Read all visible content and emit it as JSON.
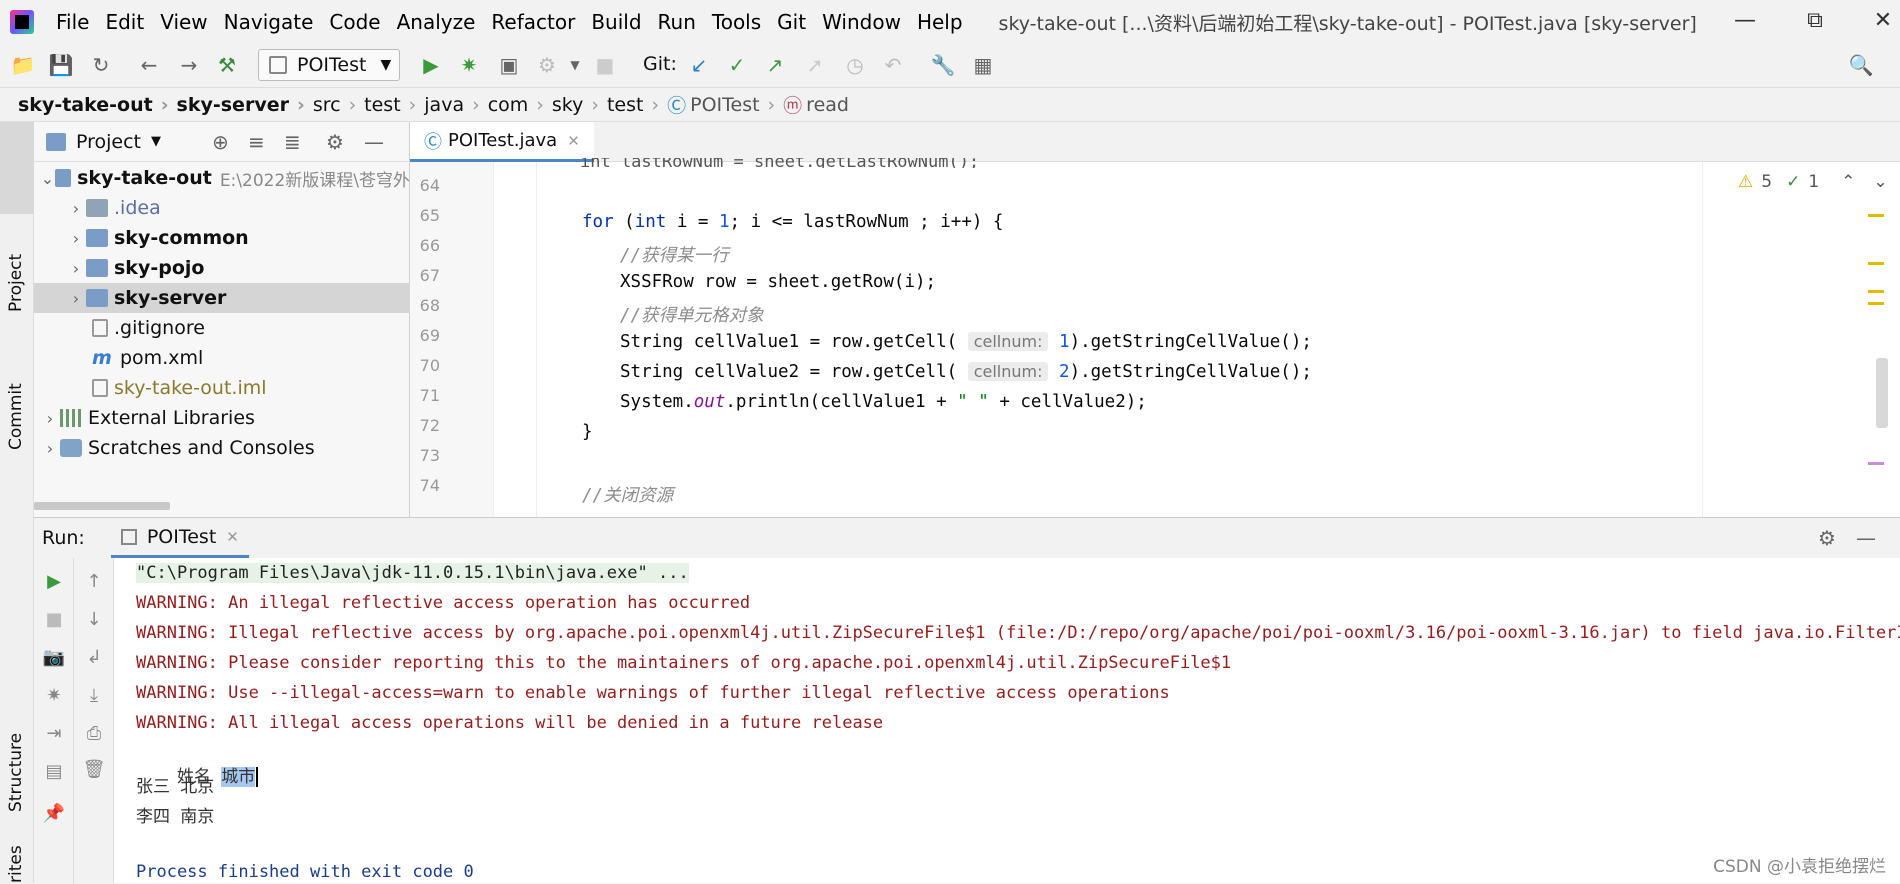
{
  "menubar": {
    "items": [
      "File",
      "Edit",
      "View",
      "Navigate",
      "Code",
      "Analyze",
      "Refactor",
      "Build",
      "Run",
      "Tools",
      "Git",
      "Window",
      "Help"
    ],
    "window_title": "sky-take-out [...\\资料\\后端初始工程\\sky-take-out] - POITest.java [sky-server]"
  },
  "toolbar": {
    "run_config": "POITest",
    "git_label": "Git:"
  },
  "breadcrumb": [
    "sky-take-out",
    "sky-server",
    "src",
    "test",
    "java",
    "com",
    "sky",
    "test",
    "POITest",
    "read"
  ],
  "left_strip": {
    "tab1": "Project",
    "tab2": "Commit",
    "tab3": "Structure",
    "tab4": "rites"
  },
  "project_panel": {
    "title": "Project",
    "tree": [
      {
        "label": "sky-take-out",
        "extra": "E:\\2022新版课程\\苍穹外",
        "level": 0,
        "expanded": true,
        "bold": true
      },
      {
        "label": ".idea",
        "level": 1,
        "color": "#5b6ea8"
      },
      {
        "label": "sky-common",
        "level": 1,
        "bold": true
      },
      {
        "label": "sky-pojo",
        "level": 1,
        "bold": true
      },
      {
        "label": "sky-server",
        "level": 1,
        "bold": true,
        "selected": true
      },
      {
        "label": ".gitignore",
        "level": 2
      },
      {
        "label": "pom.xml",
        "level": 2
      },
      {
        "label": "sky-take-out.iml",
        "level": 2,
        "color": "#8a7a2a"
      },
      {
        "label": "External Libraries",
        "level": 0
      },
      {
        "label": "Scratches and Consoles",
        "level": 0
      }
    ]
  },
  "editor": {
    "tab_label": "POITest.java",
    "warnings": "5",
    "weak_warnings": "1",
    "line_numbers": [
      "64",
      "65",
      "66",
      "67",
      "68",
      "69",
      "70",
      "71",
      "72",
      "73",
      "74"
    ],
    "lines": {
      "top_partial": "int lastRowNum = sheet.getLastRowNum();",
      "l65_for": "for",
      "l65_a": " (",
      "l65_int": "int",
      "l65_b": " i = ",
      "l65_one": "1",
      "l65_c": "; i <= lastRowNum ; i++) {",
      "l66": "//获得某一行",
      "l67": "XSSFRow row = sheet.getRow(i);",
      "l68": "//获得单元格对象",
      "l69_a": "String cellValue1 = row.getCell( ",
      "l69_hint": "cellnum:",
      "l69_num": " 1",
      "l69_b": ").getStringCellValue();",
      "l70_a": "String cellValue2 = row.getCell( ",
      "l70_hint": "cellnum:",
      "l70_num": " 2",
      "l70_b": ").getStringCellValue();",
      "l71_a": "System.",
      "l71_out": "out",
      "l71_b": ".println(cellValue1 + ",
      "l71_str": "\" \"",
      "l71_c": " + cellValue2);",
      "l72": "}",
      "l74": "//关闭资源"
    }
  },
  "run_panel": {
    "label": "Run:",
    "tab": "POITest",
    "output": {
      "cmd": "\"C:\\Program Files\\Java\\jdk-11.0.15.1\\bin\\java.exe\" ...",
      "w1": "WARNING: An illegal reflective access operation has occurred",
      "w2": "WARNING: Illegal reflective access by org.apache.poi.openxml4j.util.ZipSecureFile$1 (file:/D:/repo/org/apache/poi/poi-ooxml/3.16/poi-ooxml-3.16.jar) to field java.io.FilterInpu",
      "w3": "WARNING: Please consider reporting this to the maintainers of org.apache.poi.openxml4j.util.ZipSecureFile$1",
      "w4": "WARNING: Use --illegal-access=warn to enable warnings of further illegal reflective access operations",
      "w5": "WARNING: All illegal access operations will be denied in a future release",
      "r1a": "姓名",
      "r1b": "城市",
      "r2": "张三 北京",
      "r3": "李四 南京",
      "exit": "Process finished with exit code 0"
    }
  },
  "watermark": "CSDN @小袁拒绝摆烂"
}
